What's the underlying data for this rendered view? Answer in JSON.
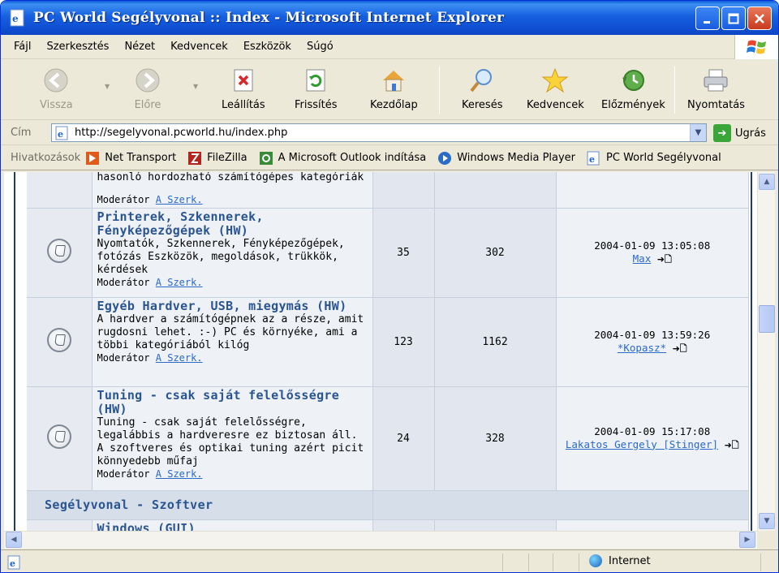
{
  "window": {
    "title": "PC World Segélyvonal :: Index - Microsoft Internet Explorer"
  },
  "menu": [
    "Fájl",
    "Szerkesztés",
    "Nézet",
    "Kedvencek",
    "Eszközök",
    "Súgó"
  ],
  "toolbar": {
    "back": "Vissza",
    "forward": "Előre",
    "stop": "Leállítás",
    "refresh": "Frissítés",
    "home": "Kezdőlap",
    "search": "Keresés",
    "favorites": "Kedvencek",
    "history": "Előzmények",
    "print": "Nyomtatás"
  },
  "address": {
    "label": "Cím",
    "url": "http://segelyvonal.pcworld.hu/index.php",
    "go": "Ugrás"
  },
  "links": {
    "label": "Hivatkozások",
    "items": [
      "Net Transport",
      "FileZilla",
      "A Microsoft Outlook indítása",
      "Windows Media Player",
      "PC World Segélyvonal"
    ]
  },
  "forum": {
    "top_partial": {
      "desc_tail": "hasonló hordozható számítógépes kategóriák",
      "moderator_label": "Moderátor",
      "moderator": "A Szerk."
    },
    "rows": [
      {
        "title": "Printerek, Szkennerek, Fényképezőgépek (HW)",
        "desc": "Nyomtatók, Szkennerek, Fényképezőgépek, fotózás Eszközök, megoldások, trükkök, kérdések",
        "moderator_label": "Moderátor",
        "moderator": "A Szerk.",
        "topics": "35",
        "posts": "302",
        "last_date": "2004-01-09 13:05:08",
        "last_user": "Max"
      },
      {
        "title": "Egyéb Hardver, USB, miegymás (HW)",
        "desc": "A hardver a számítógépnek az a része, amit rugdosni lehet. :-) PC és környéke, ami a többi kategóriából kilóg",
        "moderator_label": "Moderátor",
        "moderator": "A Szerk.",
        "topics": "123",
        "posts": "1162",
        "last_date": "2004-01-09 13:59:26",
        "last_user": "*Kopasz*"
      },
      {
        "title": "Tuning - csak saját felelősségre (HW)",
        "desc": "Tuning - csak saját felelősségre, legalábbis a hardveresre ez biztosan áll. A szoftveres és optikai tuning azért picit könnyedebb műfaj",
        "moderator_label": "Moderátor",
        "moderator": "A Szerk.",
        "topics": "24",
        "posts": "328",
        "last_date": "2004-01-09 15:17:08",
        "last_user": "Lakatos Gergely [Stinger]"
      }
    ],
    "category": "Segélyvonal - Szoftver",
    "next_partial": "Windows (GUI)"
  },
  "status": {
    "zone": "Internet"
  }
}
